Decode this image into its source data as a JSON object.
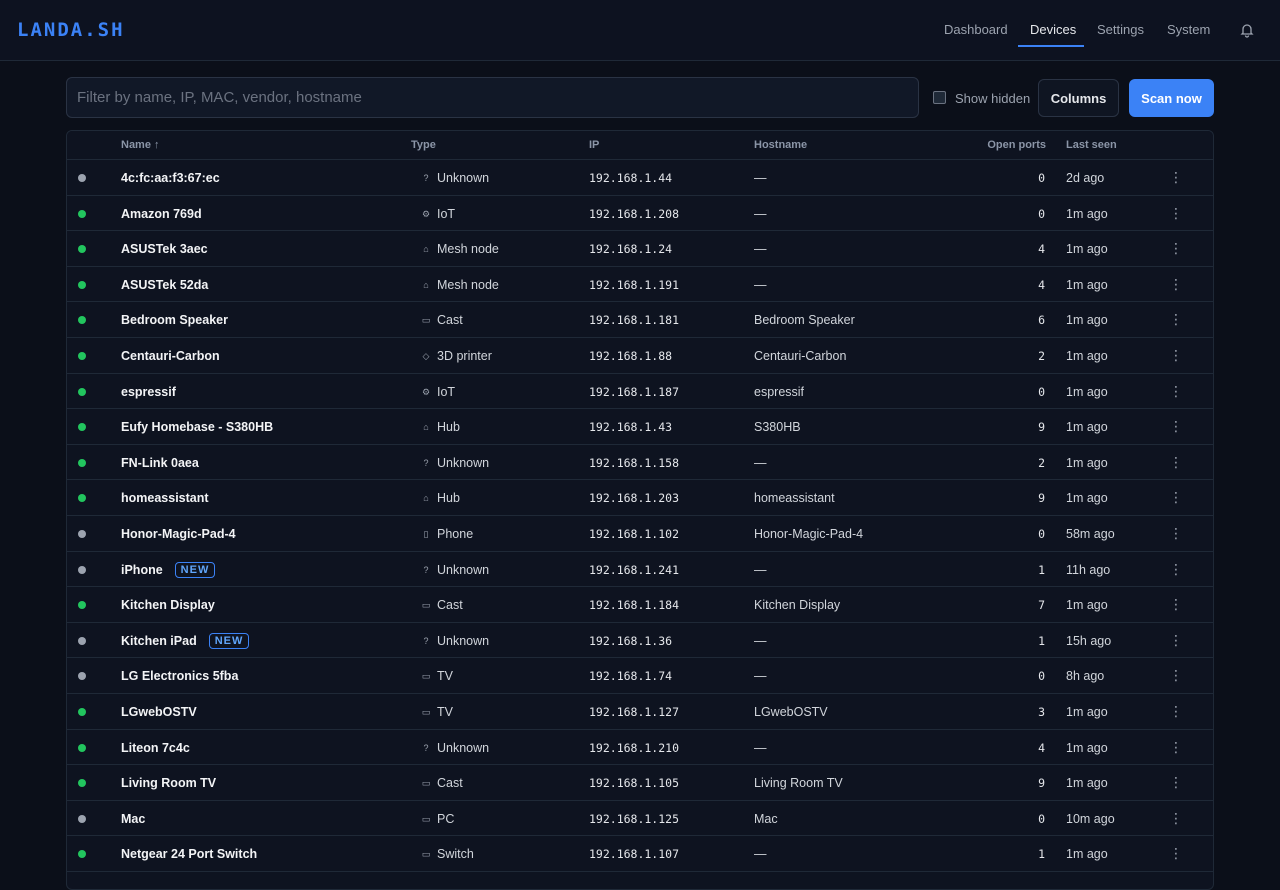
{
  "app": {
    "brand": "LANDA.SH"
  },
  "nav": {
    "items": [
      {
        "label": "Dashboard",
        "active": false
      },
      {
        "label": "Devices",
        "active": true
      },
      {
        "label": "Settings",
        "active": false
      },
      {
        "label": "System",
        "active": false
      }
    ],
    "bell_icon": "bell-icon"
  },
  "toolbar": {
    "filter_placeholder": "Filter by name, IP, MAC, vendor, hostname",
    "filter_value": "",
    "show_hidden_label": "Show hidden",
    "show_hidden_checked": false,
    "columns_label": "Columns",
    "scan_label": "Scan now"
  },
  "table": {
    "columns": [
      "Name ↑",
      "Type",
      "IP",
      "Hostname",
      "Open ports",
      "Last seen"
    ],
    "status_colors": {
      "online": "#22c55e",
      "offline": "#9ca3af"
    },
    "rows": [
      {
        "status": "offline",
        "name": "4c:fc:aa:f3:67:ec",
        "badge": "",
        "type": "Unknown",
        "type_icon": "question-icon",
        "ip": "192.168.1.44",
        "hostname": "—",
        "ports": "0",
        "seen": "2d ago"
      },
      {
        "status": "online",
        "name": "Amazon 769d",
        "badge": "",
        "type": "IoT",
        "type_icon": "chip-icon",
        "ip": "192.168.1.208",
        "hostname": "—",
        "ports": "0",
        "seen": "1m ago"
      },
      {
        "status": "online",
        "name": "ASUSTek 3aec",
        "badge": "",
        "type": "Mesh node",
        "type_icon": "router-icon",
        "ip": "192.168.1.24",
        "hostname": "—",
        "ports": "4",
        "seen": "1m ago"
      },
      {
        "status": "online",
        "name": "ASUSTek 52da",
        "badge": "",
        "type": "Mesh node",
        "type_icon": "router-icon",
        "ip": "192.168.1.191",
        "hostname": "—",
        "ports": "4",
        "seen": "1m ago"
      },
      {
        "status": "online",
        "name": "Bedroom Speaker",
        "badge": "",
        "type": "Cast",
        "type_icon": "cast-icon",
        "ip": "192.168.1.181",
        "hostname": "Bedroom Speaker",
        "ports": "6",
        "seen": "1m ago"
      },
      {
        "status": "online",
        "name": "Centauri-Carbon",
        "badge": "",
        "type": "3D printer",
        "type_icon": "cube-icon",
        "ip": "192.168.1.88",
        "hostname": "Centauri-Carbon",
        "ports": "2",
        "seen": "1m ago"
      },
      {
        "status": "online",
        "name": "espressif",
        "badge": "",
        "type": "IoT",
        "type_icon": "chip-icon",
        "ip": "192.168.1.187",
        "hostname": "espressif",
        "ports": "0",
        "seen": "1m ago"
      },
      {
        "status": "online",
        "name": "Eufy Homebase - S380HB",
        "badge": "",
        "type": "Hub",
        "type_icon": "home-icon",
        "ip": "192.168.1.43",
        "hostname": "S380HB",
        "ports": "9",
        "seen": "1m ago"
      },
      {
        "status": "online",
        "name": "FN-Link 0aea",
        "badge": "",
        "type": "Unknown",
        "type_icon": "question-icon",
        "ip": "192.168.1.158",
        "hostname": "—",
        "ports": "2",
        "seen": "1m ago"
      },
      {
        "status": "online",
        "name": "homeassistant",
        "badge": "",
        "type": "Hub",
        "type_icon": "home-icon",
        "ip": "192.168.1.203",
        "hostname": "homeassistant",
        "ports": "9",
        "seen": "1m ago"
      },
      {
        "status": "offline",
        "name": "Honor-Magic-Pad-4",
        "badge": "",
        "type": "Phone",
        "type_icon": "phone-icon",
        "ip": "192.168.1.102",
        "hostname": "Honor-Magic-Pad-4",
        "ports": "0",
        "seen": "58m ago"
      },
      {
        "status": "offline",
        "name": "iPhone",
        "badge": "NEW",
        "type": "Unknown",
        "type_icon": "question-icon",
        "ip": "192.168.1.241",
        "hostname": "—",
        "ports": "1",
        "seen": "11h ago"
      },
      {
        "status": "online",
        "name": "Kitchen Display",
        "badge": "",
        "type": "Cast",
        "type_icon": "cast-icon",
        "ip": "192.168.1.184",
        "hostname": "Kitchen Display",
        "ports": "7",
        "seen": "1m ago"
      },
      {
        "status": "offline",
        "name": "Kitchen iPad",
        "badge": "NEW",
        "type": "Unknown",
        "type_icon": "question-icon",
        "ip": "192.168.1.36",
        "hostname": "—",
        "ports": "1",
        "seen": "15h ago"
      },
      {
        "status": "offline",
        "name": "LG Electronics 5fba",
        "badge": "",
        "type": "TV",
        "type_icon": "tv-icon",
        "ip": "192.168.1.74",
        "hostname": "—",
        "ports": "0",
        "seen": "8h ago"
      },
      {
        "status": "online",
        "name": "LGwebOSTV",
        "badge": "",
        "type": "TV",
        "type_icon": "tv-icon",
        "ip": "192.168.1.127",
        "hostname": "LGwebOSTV",
        "ports": "3",
        "seen": "1m ago"
      },
      {
        "status": "online",
        "name": "Liteon 7c4c",
        "badge": "",
        "type": "Unknown",
        "type_icon": "question-icon",
        "ip": "192.168.1.210",
        "hostname": "—",
        "ports": "4",
        "seen": "1m ago"
      },
      {
        "status": "online",
        "name": "Living Room TV",
        "badge": "",
        "type": "Cast",
        "type_icon": "cast-icon",
        "ip": "192.168.1.105",
        "hostname": "Living Room TV",
        "ports": "9",
        "seen": "1m ago"
      },
      {
        "status": "offline",
        "name": "Mac",
        "badge": "",
        "type": "PC",
        "type_icon": "laptop-icon",
        "ip": "192.168.1.125",
        "hostname": "Mac",
        "ports": "0",
        "seen": "10m ago"
      },
      {
        "status": "online",
        "name": "Netgear 24 Port Switch",
        "badge": "",
        "type": "Switch",
        "type_icon": "switch-icon",
        "ip": "192.168.1.107",
        "hostname": "—",
        "ports": "1",
        "seen": "1m ago"
      }
    ]
  }
}
